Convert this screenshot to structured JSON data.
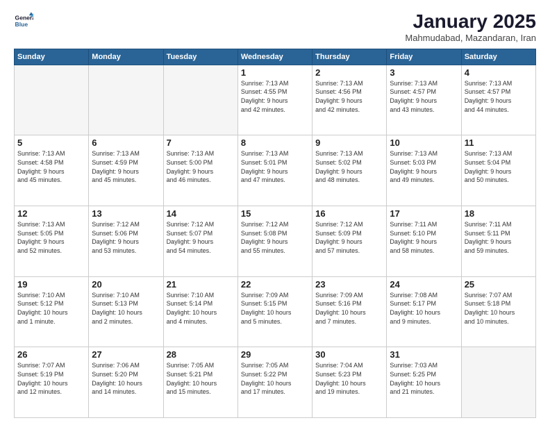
{
  "logo": {
    "line1": "General",
    "line2": "Blue"
  },
  "title": "January 2025",
  "subtitle": "Mahmudabad, Mazandaran, Iran",
  "weekdays": [
    "Sunday",
    "Monday",
    "Tuesday",
    "Wednesday",
    "Thursday",
    "Friday",
    "Saturday"
  ],
  "weeks": [
    [
      {
        "day": "",
        "info": ""
      },
      {
        "day": "",
        "info": ""
      },
      {
        "day": "",
        "info": ""
      },
      {
        "day": "1",
        "info": "Sunrise: 7:13 AM\nSunset: 4:55 PM\nDaylight: 9 hours\nand 42 minutes."
      },
      {
        "day": "2",
        "info": "Sunrise: 7:13 AM\nSunset: 4:56 PM\nDaylight: 9 hours\nand 42 minutes."
      },
      {
        "day": "3",
        "info": "Sunrise: 7:13 AM\nSunset: 4:57 PM\nDaylight: 9 hours\nand 43 minutes."
      },
      {
        "day": "4",
        "info": "Sunrise: 7:13 AM\nSunset: 4:57 PM\nDaylight: 9 hours\nand 44 minutes."
      }
    ],
    [
      {
        "day": "5",
        "info": "Sunrise: 7:13 AM\nSunset: 4:58 PM\nDaylight: 9 hours\nand 45 minutes."
      },
      {
        "day": "6",
        "info": "Sunrise: 7:13 AM\nSunset: 4:59 PM\nDaylight: 9 hours\nand 45 minutes."
      },
      {
        "day": "7",
        "info": "Sunrise: 7:13 AM\nSunset: 5:00 PM\nDaylight: 9 hours\nand 46 minutes."
      },
      {
        "day": "8",
        "info": "Sunrise: 7:13 AM\nSunset: 5:01 PM\nDaylight: 9 hours\nand 47 minutes."
      },
      {
        "day": "9",
        "info": "Sunrise: 7:13 AM\nSunset: 5:02 PM\nDaylight: 9 hours\nand 48 minutes."
      },
      {
        "day": "10",
        "info": "Sunrise: 7:13 AM\nSunset: 5:03 PM\nDaylight: 9 hours\nand 49 minutes."
      },
      {
        "day": "11",
        "info": "Sunrise: 7:13 AM\nSunset: 5:04 PM\nDaylight: 9 hours\nand 50 minutes."
      }
    ],
    [
      {
        "day": "12",
        "info": "Sunrise: 7:13 AM\nSunset: 5:05 PM\nDaylight: 9 hours\nand 52 minutes."
      },
      {
        "day": "13",
        "info": "Sunrise: 7:12 AM\nSunset: 5:06 PM\nDaylight: 9 hours\nand 53 minutes."
      },
      {
        "day": "14",
        "info": "Sunrise: 7:12 AM\nSunset: 5:07 PM\nDaylight: 9 hours\nand 54 minutes."
      },
      {
        "day": "15",
        "info": "Sunrise: 7:12 AM\nSunset: 5:08 PM\nDaylight: 9 hours\nand 55 minutes."
      },
      {
        "day": "16",
        "info": "Sunrise: 7:12 AM\nSunset: 5:09 PM\nDaylight: 9 hours\nand 57 minutes."
      },
      {
        "day": "17",
        "info": "Sunrise: 7:11 AM\nSunset: 5:10 PM\nDaylight: 9 hours\nand 58 minutes."
      },
      {
        "day": "18",
        "info": "Sunrise: 7:11 AM\nSunset: 5:11 PM\nDaylight: 9 hours\nand 59 minutes."
      }
    ],
    [
      {
        "day": "19",
        "info": "Sunrise: 7:10 AM\nSunset: 5:12 PM\nDaylight: 10 hours\nand 1 minute."
      },
      {
        "day": "20",
        "info": "Sunrise: 7:10 AM\nSunset: 5:13 PM\nDaylight: 10 hours\nand 2 minutes."
      },
      {
        "day": "21",
        "info": "Sunrise: 7:10 AM\nSunset: 5:14 PM\nDaylight: 10 hours\nand 4 minutes."
      },
      {
        "day": "22",
        "info": "Sunrise: 7:09 AM\nSunset: 5:15 PM\nDaylight: 10 hours\nand 5 minutes."
      },
      {
        "day": "23",
        "info": "Sunrise: 7:09 AM\nSunset: 5:16 PM\nDaylight: 10 hours\nand 7 minutes."
      },
      {
        "day": "24",
        "info": "Sunrise: 7:08 AM\nSunset: 5:17 PM\nDaylight: 10 hours\nand 9 minutes."
      },
      {
        "day": "25",
        "info": "Sunrise: 7:07 AM\nSunset: 5:18 PM\nDaylight: 10 hours\nand 10 minutes."
      }
    ],
    [
      {
        "day": "26",
        "info": "Sunrise: 7:07 AM\nSunset: 5:19 PM\nDaylight: 10 hours\nand 12 minutes."
      },
      {
        "day": "27",
        "info": "Sunrise: 7:06 AM\nSunset: 5:20 PM\nDaylight: 10 hours\nand 14 minutes."
      },
      {
        "day": "28",
        "info": "Sunrise: 7:05 AM\nSunset: 5:21 PM\nDaylight: 10 hours\nand 15 minutes."
      },
      {
        "day": "29",
        "info": "Sunrise: 7:05 AM\nSunset: 5:22 PM\nDaylight: 10 hours\nand 17 minutes."
      },
      {
        "day": "30",
        "info": "Sunrise: 7:04 AM\nSunset: 5:23 PM\nDaylight: 10 hours\nand 19 minutes."
      },
      {
        "day": "31",
        "info": "Sunrise: 7:03 AM\nSunset: 5:25 PM\nDaylight: 10 hours\nand 21 minutes."
      },
      {
        "day": "",
        "info": ""
      }
    ]
  ]
}
